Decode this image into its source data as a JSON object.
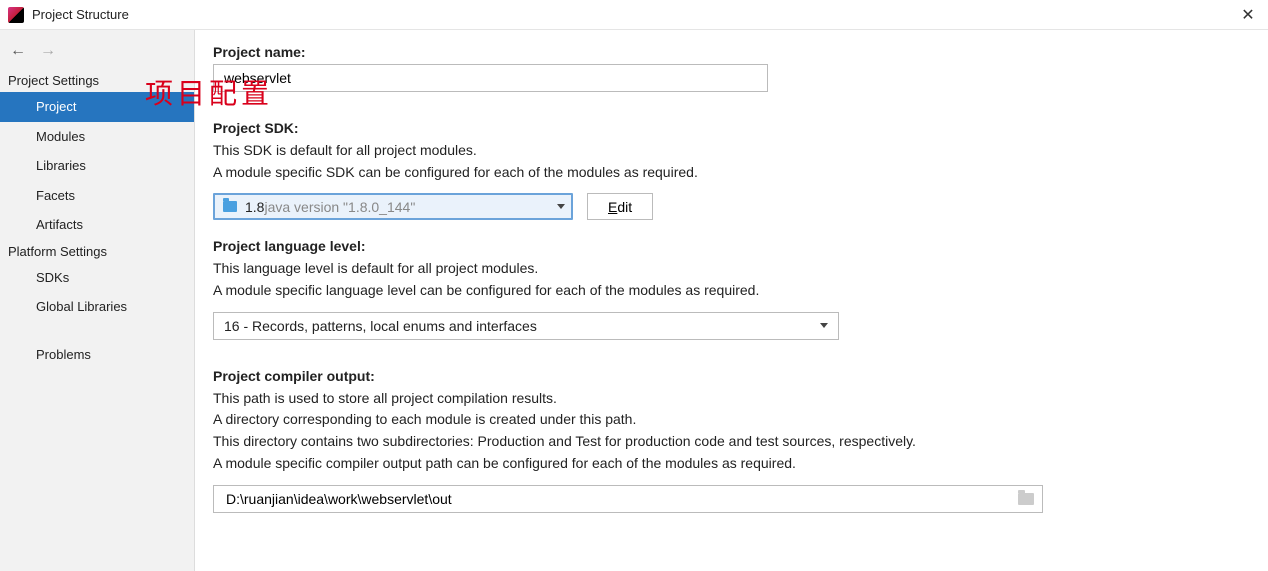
{
  "window": {
    "title": "Project Structure"
  },
  "sidebar": {
    "project_settings_header": "Project Settings",
    "platform_settings_header": "Platform Settings",
    "items": {
      "project": "Project",
      "modules": "Modules",
      "libraries": "Libraries",
      "facets": "Facets",
      "artifacts": "Artifacts",
      "sdks": "SDKs",
      "global_libraries": "Global Libraries",
      "problems": "Problems"
    }
  },
  "main": {
    "project_name_label": "Project name:",
    "project_name_value": "webservlet",
    "project_sdk_label": "Project SDK:",
    "project_sdk_desc1": "This SDK is default for all project modules.",
    "project_sdk_desc2": "A module specific SDK can be configured for each of the modules as required.",
    "sdk_selected_name": "1.8",
    "sdk_selected_version": " java version \"1.8.0_144\"",
    "edit_button": "Edit",
    "lang_level_label": "Project language level:",
    "lang_level_desc1": "This language level is default for all project modules.",
    "lang_level_desc2": "A module specific language level can be configured for each of the modules as required.",
    "lang_level_value": "16 - Records, patterns, local enums and interfaces",
    "compiler_output_label": "Project compiler output:",
    "compiler_output_desc1": "This path is used to store all project compilation results.",
    "compiler_output_desc2": "A directory corresponding to each module is created under this path.",
    "compiler_output_desc3": "This directory contains two subdirectories: Production and Test for production code and test sources, respectively.",
    "compiler_output_desc4": "A module specific compiler output path can be configured for each of the modules as required.",
    "compiler_output_value": "D:\\ruanjian\\idea\\work\\webservlet\\out"
  },
  "annotation": "项目配置"
}
